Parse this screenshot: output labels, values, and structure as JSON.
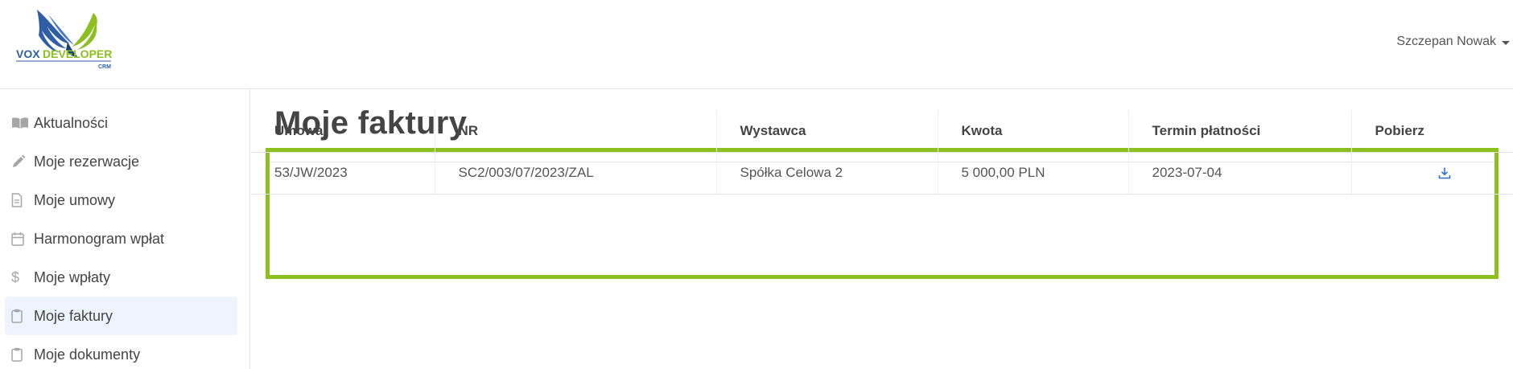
{
  "header": {
    "logo": {
      "brand_part1": "VOX",
      "brand_part2": "DEVELOPER",
      "brand_sub": "CRM",
      "colors": {
        "blue": "#2f5ea8",
        "green": "#8cbf20"
      }
    },
    "user_name": "Szczepan Nowak"
  },
  "sidebar": {
    "items": [
      {
        "label": "Aktualności",
        "icon": "book-open-icon",
        "active": false
      },
      {
        "label": "Moje rezerwacje",
        "icon": "pencil-icon",
        "active": false
      },
      {
        "label": "Moje umowy",
        "icon": "document-icon",
        "active": false
      },
      {
        "label": "Harmonogram wpłat",
        "icon": "calendar-icon",
        "active": false
      },
      {
        "label": "Moje wpłaty",
        "icon": "dollar-icon",
        "active": false
      },
      {
        "label": "Moje faktury",
        "icon": "clipboard-icon",
        "active": true
      },
      {
        "label": "Moje dokumenty",
        "icon": "clipboard-icon",
        "active": false
      }
    ]
  },
  "main": {
    "title": "Moje faktury",
    "highlight_color": "#8cbf20",
    "table": {
      "columns": [
        "Umowa",
        "NR",
        "Wystawca",
        "Kwota",
        "Termin płatności",
        "Pobierz"
      ],
      "rows": [
        {
          "umowa": "53/JW/2023",
          "nr": "SC2/003/07/2023/ZAL",
          "wystawca": "Spółka Celowa 2",
          "kwota": "5 000,00 PLN",
          "termin": "2023-07-04",
          "pobierz_icon": "download-icon"
        }
      ]
    }
  }
}
